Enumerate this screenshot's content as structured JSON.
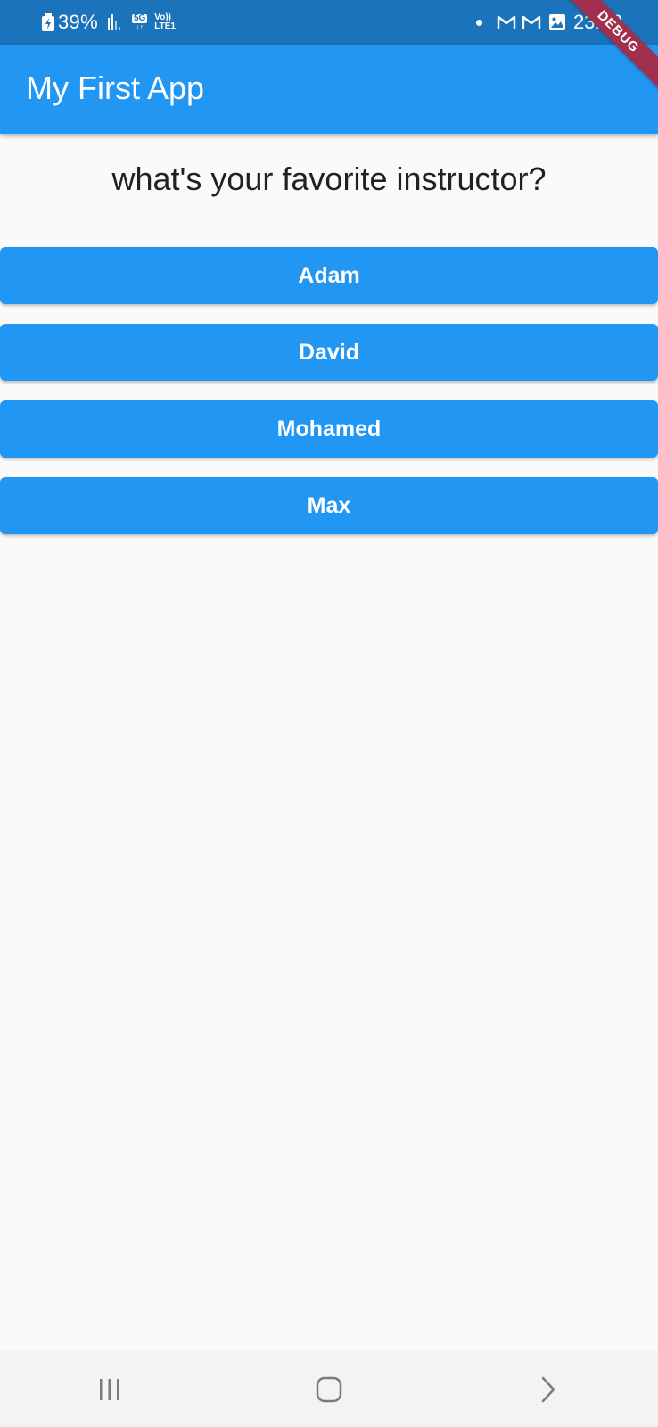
{
  "status_bar": {
    "battery": "39%",
    "network_5g": "5G",
    "network_arrows": "↓↑",
    "volte_top": "Vo))",
    "volte_bottom": "LTE1",
    "time": "23:18",
    "icons": [
      "battery-charging-icon",
      "signal-strength-icon",
      "dot-icon",
      "gmail-icon",
      "gmail-icon",
      "gallery-icon"
    ]
  },
  "app_bar": {
    "title": "My First App",
    "debug_banner": "DEBUG"
  },
  "quiz": {
    "question": "what's your favorite instructor?",
    "answers": [
      {
        "label": "Adam"
      },
      {
        "label": "David"
      },
      {
        "label": "Mohamed"
      },
      {
        "label": "Max"
      }
    ]
  },
  "nav_bar": {
    "icons": [
      "recent-apps-icon",
      "home-icon",
      "back-icon"
    ]
  },
  "colors": {
    "status_bar": "#1b73bb",
    "primary": "#2196f3",
    "background": "#fafafa",
    "debug_ribbon": "#a0304e",
    "text": "#212121"
  }
}
